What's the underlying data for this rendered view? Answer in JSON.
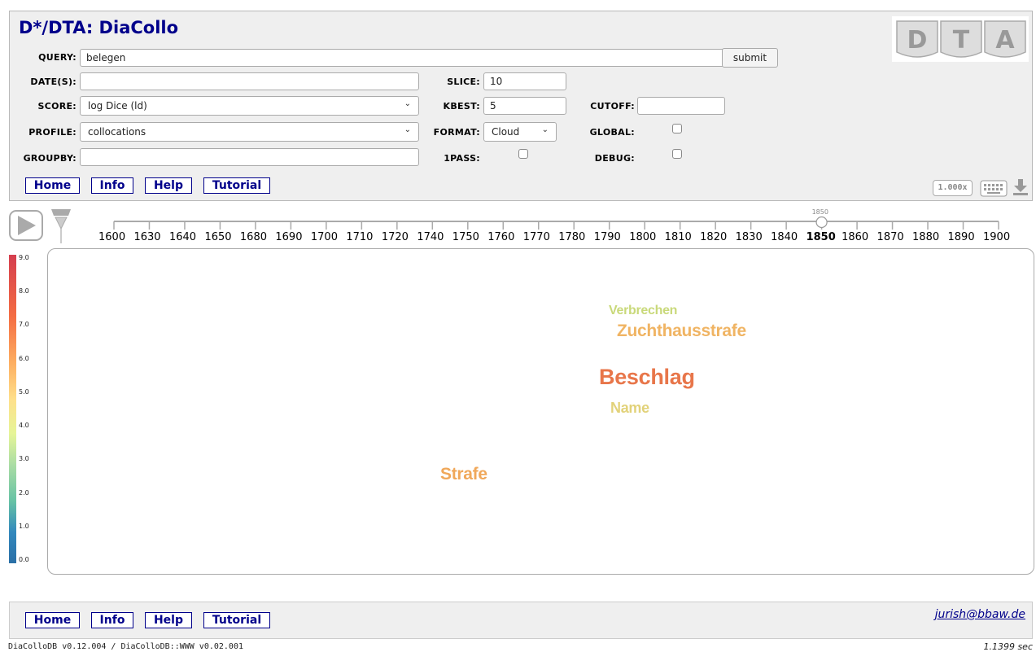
{
  "header": {
    "title": "D*/DTA: DiaCollo",
    "logo_letters": [
      "D",
      "T",
      "A"
    ],
    "submit_label": "submit",
    "zoom_label": "1.000x"
  },
  "form": {
    "query": {
      "label": "QUERY:",
      "value": "belegen"
    },
    "dates": {
      "label": "DATE(S):",
      "value": ""
    },
    "score": {
      "label": "SCORE:",
      "value": "log Dice (ld)"
    },
    "profile": {
      "label": "PROFILE:",
      "value": "collocations"
    },
    "groupby": {
      "label": "GROUPBY:",
      "value": ""
    },
    "slice": {
      "label": "SLICE:",
      "value": "10"
    },
    "kbest": {
      "label": "KBEST:",
      "value": "5"
    },
    "format": {
      "label": "FORMAT:",
      "value": "Cloud"
    },
    "onepass": {
      "label": "1PASS:",
      "checked": false
    },
    "cutoff": {
      "label": "CUTOFF:",
      "value": ""
    },
    "global": {
      "label": "GLOBAL:",
      "checked": false
    },
    "debug": {
      "label": "DEBUG:",
      "checked": false
    }
  },
  "nav": {
    "home": "Home",
    "info": "Info",
    "help": "Help",
    "tutorial": "Tutorial"
  },
  "timeline": {
    "ticks": [
      "1600",
      "1630",
      "1640",
      "1650",
      "1680",
      "1690",
      "1700",
      "1710",
      "1720",
      "1740",
      "1750",
      "1760",
      "1770",
      "1780",
      "1790",
      "1800",
      "1810",
      "1820",
      "1830",
      "1840",
      "1850",
      "1860",
      "1870",
      "1880",
      "1890",
      "1900"
    ],
    "selected": "1850",
    "handle_label": "1850"
  },
  "legend": {
    "labels": [
      "9.0",
      "8.0",
      "7.0",
      "6.0",
      "5.0",
      "4.0",
      "3.0",
      "2.0",
      "1.0",
      "0.0"
    ]
  },
  "cloud": {
    "words": [
      {
        "text": "Verbrechen",
        "score": 4.2,
        "color": "#c9d97a"
      },
      {
        "text": "Zuchthausstrafe",
        "score": 5.9,
        "color": "#f0b463"
      },
      {
        "text": "Beschlag",
        "score": 7.4,
        "color": "#e8764a"
      },
      {
        "text": "Name",
        "score": 5.0,
        "color": "#e2d27a"
      },
      {
        "text": "Strafe",
        "score": 6.2,
        "color": "#f0a85a"
      }
    ]
  },
  "footer": {
    "email": "jurish@bbaw.de",
    "version": "DiaColloDB v0.12.004 / DiaColloDB::WWW v0.02.001",
    "timing": "1.1399 sec"
  }
}
